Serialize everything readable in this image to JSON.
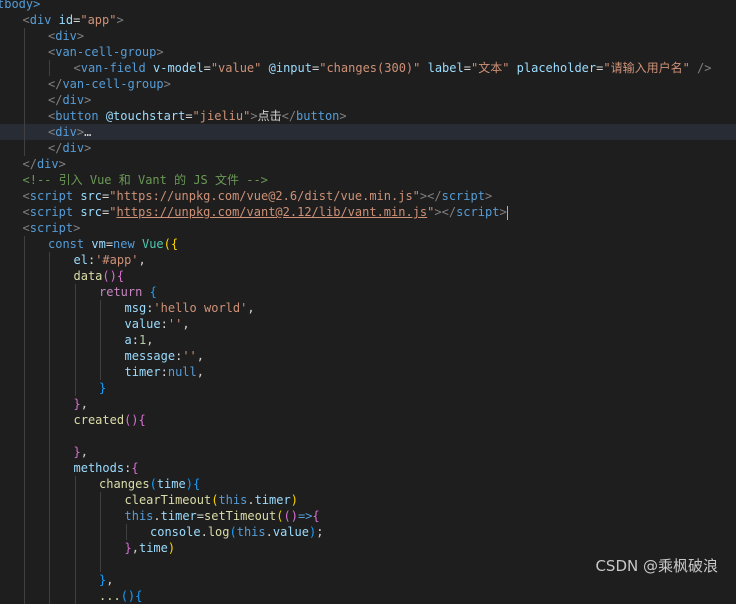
{
  "theme": {
    "background": "#1e1e1e",
    "current_line": "#282d35",
    "tag": "#569cd6",
    "attribute": "#9cdcfe",
    "string": "#ce9178",
    "comment": "#6a9955",
    "control": "#c586c0",
    "function": "#dcdcaa",
    "class": "#4ec9b0",
    "number": "#b5cea8"
  },
  "editor": {
    "current_line_index": 8,
    "lines": [
      {
        "indent": 0,
        "tokens": [
          {
            "t": "tag",
            "v": "tbody>"
          }
        ]
      },
      {
        "indent": 1,
        "tokens": [
          {
            "t": "bracket",
            "v": "<"
          },
          {
            "t": "tag",
            "v": "div"
          },
          {
            "t": "text",
            "v": " "
          },
          {
            "t": "attr",
            "v": "id"
          },
          {
            "t": "text",
            "v": "="
          },
          {
            "t": "string",
            "v": "\"app\""
          },
          {
            "t": "bracket",
            "v": ">"
          }
        ]
      },
      {
        "indent": 2,
        "tokens": [
          {
            "t": "bracket",
            "v": "<"
          },
          {
            "t": "tag",
            "v": "div"
          },
          {
            "t": "bracket",
            "v": ">"
          }
        ]
      },
      {
        "indent": 2,
        "tokens": [
          {
            "t": "bracket",
            "v": "<"
          },
          {
            "t": "tag",
            "v": "van-cell-group"
          },
          {
            "t": "bracket",
            "v": ">"
          }
        ]
      },
      {
        "indent": 3,
        "tokens": [
          {
            "t": "bracket",
            "v": "<"
          },
          {
            "t": "tag",
            "v": "van-field"
          },
          {
            "t": "text",
            "v": " "
          },
          {
            "t": "attr",
            "v": "v-model"
          },
          {
            "t": "text",
            "v": "="
          },
          {
            "t": "string",
            "v": "\"value\""
          },
          {
            "t": "text",
            "v": " "
          },
          {
            "t": "attr",
            "v": "@input"
          },
          {
            "t": "text",
            "v": "="
          },
          {
            "t": "string",
            "v": "\"changes(300)\""
          },
          {
            "t": "text",
            "v": " "
          },
          {
            "t": "attr",
            "v": "label"
          },
          {
            "t": "text",
            "v": "="
          },
          {
            "t": "string",
            "v": "\"文本\""
          },
          {
            "t": "text",
            "v": " "
          },
          {
            "t": "attr",
            "v": "placeholder"
          },
          {
            "t": "text",
            "v": "="
          },
          {
            "t": "string",
            "v": "\"请输入用户名\""
          },
          {
            "t": "text",
            "v": " "
          },
          {
            "t": "bracket",
            "v": "/>"
          }
        ]
      },
      {
        "indent": 2,
        "tokens": [
          {
            "t": "bracket",
            "v": "</"
          },
          {
            "t": "tag",
            "v": "van-cell-group"
          },
          {
            "t": "bracket",
            "v": ">"
          }
        ]
      },
      {
        "indent": 2,
        "tokens": [
          {
            "t": "bracket",
            "v": "</"
          },
          {
            "t": "tag",
            "v": "div"
          },
          {
            "t": "bracket",
            "v": ">"
          }
        ]
      },
      {
        "indent": 2,
        "tokens": [
          {
            "t": "bracket",
            "v": "<"
          },
          {
            "t": "tag",
            "v": "button"
          },
          {
            "t": "text",
            "v": " "
          },
          {
            "t": "attr",
            "v": "@touchstart"
          },
          {
            "t": "text",
            "v": "="
          },
          {
            "t": "string",
            "v": "\"jieliu\""
          },
          {
            "t": "bracket",
            "v": ">"
          },
          {
            "t": "text",
            "v": "点击"
          },
          {
            "t": "bracket",
            "v": "</"
          },
          {
            "t": "tag",
            "v": "button"
          },
          {
            "t": "bracket",
            "v": ">"
          }
        ]
      },
      {
        "indent": 2,
        "tokens": [
          {
            "t": "bracket",
            "v": "<"
          },
          {
            "t": "tag",
            "v": "div"
          },
          {
            "t": "bracket",
            "v": ">"
          },
          {
            "t": "fold",
            "v": "…"
          }
        ]
      },
      {
        "indent": 2,
        "tokens": [
          {
            "t": "bracket",
            "v": "</"
          },
          {
            "t": "tag",
            "v": "div"
          },
          {
            "t": "bracket",
            "v": ">"
          }
        ]
      },
      {
        "indent": 1,
        "tokens": [
          {
            "t": "bracket",
            "v": "</"
          },
          {
            "t": "tag",
            "v": "div"
          },
          {
            "t": "bracket",
            "v": ">"
          }
        ]
      },
      {
        "indent": 1,
        "tokens": [
          {
            "t": "comment",
            "v": "<!-- 引入 Vue 和 Vant 的 JS 文件 -->"
          }
        ]
      },
      {
        "indent": 1,
        "tokens": [
          {
            "t": "bracket",
            "v": "<"
          },
          {
            "t": "tag",
            "v": "script"
          },
          {
            "t": "text",
            "v": " "
          },
          {
            "t": "attr",
            "v": "src"
          },
          {
            "t": "text",
            "v": "="
          },
          {
            "t": "string",
            "v": "\"https://unpkg.com/vue@2.6/dist/vue.min.js\""
          },
          {
            "t": "bracket",
            "v": "></"
          },
          {
            "t": "tag",
            "v": "script"
          },
          {
            "t": "bracket",
            "v": ">"
          }
        ]
      },
      {
        "indent": 1,
        "tokens": [
          {
            "t": "bracket",
            "v": "<"
          },
          {
            "t": "tag",
            "v": "script"
          },
          {
            "t": "text",
            "v": " "
          },
          {
            "t": "attr",
            "v": "src"
          },
          {
            "t": "text",
            "v": "="
          },
          {
            "t": "string",
            "v": "\""
          },
          {
            "t": "link",
            "v": "https://unpkg.com/vant@2.12/lib/vant.min.js"
          },
          {
            "t": "string",
            "v": "\""
          },
          {
            "t": "bracket",
            "v": "></"
          },
          {
            "t": "tag",
            "v": "script"
          },
          {
            "t": "bracket",
            "v": ">"
          },
          {
            "t": "cursor",
            "v": ""
          }
        ]
      },
      {
        "indent": 1,
        "tokens": [
          {
            "t": "bracket",
            "v": "<"
          },
          {
            "t": "tag",
            "v": "script"
          },
          {
            "t": "bracket",
            "v": ">"
          }
        ]
      },
      {
        "indent": 2,
        "tokens": [
          {
            "t": "keyword",
            "v": "const"
          },
          {
            "t": "plain",
            "v": " "
          },
          {
            "t": "var",
            "v": "vm"
          },
          {
            "t": "plain",
            "v": "="
          },
          {
            "t": "keyword",
            "v": "new"
          },
          {
            "t": "plain",
            "v": " "
          },
          {
            "t": "class",
            "v": "Vue"
          },
          {
            "t": "brace1",
            "v": "({"
          }
        ]
      },
      {
        "indent": 3,
        "tokens": [
          {
            "t": "var",
            "v": "el"
          },
          {
            "t": "plain",
            "v": ":"
          },
          {
            "t": "string",
            "v": "'#app'"
          },
          {
            "t": "plain",
            "v": ","
          }
        ]
      },
      {
        "indent": 3,
        "tokens": [
          {
            "t": "func",
            "v": "data"
          },
          {
            "t": "brace2",
            "v": "(){"
          }
        ]
      },
      {
        "indent": 4,
        "tokens": [
          {
            "t": "control",
            "v": "return"
          },
          {
            "t": "plain",
            "v": " "
          },
          {
            "t": "brace3",
            "v": "{"
          }
        ]
      },
      {
        "indent": 5,
        "tokens": [
          {
            "t": "var",
            "v": "msg"
          },
          {
            "t": "plain",
            "v": ":"
          },
          {
            "t": "string",
            "v": "'hello world'"
          },
          {
            "t": "plain",
            "v": ","
          }
        ]
      },
      {
        "indent": 5,
        "tokens": [
          {
            "t": "var",
            "v": "value"
          },
          {
            "t": "plain",
            "v": ":"
          },
          {
            "t": "string",
            "v": "''"
          },
          {
            "t": "plain",
            "v": ","
          }
        ]
      },
      {
        "indent": 5,
        "tokens": [
          {
            "t": "var",
            "v": "a"
          },
          {
            "t": "plain",
            "v": ":"
          },
          {
            "t": "number",
            "v": "1"
          },
          {
            "t": "plain",
            "v": ","
          }
        ]
      },
      {
        "indent": 5,
        "tokens": [
          {
            "t": "var",
            "v": "message"
          },
          {
            "t": "plain",
            "v": ":"
          },
          {
            "t": "string",
            "v": "''"
          },
          {
            "t": "plain",
            "v": ","
          }
        ]
      },
      {
        "indent": 5,
        "tokens": [
          {
            "t": "var",
            "v": "timer"
          },
          {
            "t": "plain",
            "v": ":"
          },
          {
            "t": "keyword",
            "v": "null"
          },
          {
            "t": "plain",
            "v": ","
          }
        ]
      },
      {
        "indent": 4,
        "tokens": [
          {
            "t": "brace3",
            "v": "}"
          }
        ]
      },
      {
        "indent": 3,
        "tokens": [
          {
            "t": "brace2",
            "v": "}"
          },
          {
            "t": "plain",
            "v": ","
          }
        ]
      },
      {
        "indent": 3,
        "tokens": [
          {
            "t": "func",
            "v": "created"
          },
          {
            "t": "brace2",
            "v": "(){"
          }
        ]
      },
      {
        "indent": 3,
        "tokens": []
      },
      {
        "indent": 3,
        "tokens": [
          {
            "t": "brace2",
            "v": "}"
          },
          {
            "t": "plain",
            "v": ","
          }
        ]
      },
      {
        "indent": 3,
        "tokens": [
          {
            "t": "var",
            "v": "methods"
          },
          {
            "t": "plain",
            "v": ":"
          },
          {
            "t": "brace2",
            "v": "{"
          }
        ]
      },
      {
        "indent": 4,
        "tokens": [
          {
            "t": "func",
            "v": "changes"
          },
          {
            "t": "brace3",
            "v": "("
          },
          {
            "t": "var",
            "v": "time"
          },
          {
            "t": "brace3",
            "v": ")"
          },
          {
            "t": "brace3",
            "v": "{"
          }
        ]
      },
      {
        "indent": 5,
        "tokens": [
          {
            "t": "func",
            "v": "clearTimeout"
          },
          {
            "t": "brace1",
            "v": "("
          },
          {
            "t": "keyword",
            "v": "this"
          },
          {
            "t": "plain",
            "v": "."
          },
          {
            "t": "var",
            "v": "timer"
          },
          {
            "t": "brace1",
            "v": ")"
          }
        ]
      },
      {
        "indent": 5,
        "tokens": [
          {
            "t": "keyword",
            "v": "this"
          },
          {
            "t": "plain",
            "v": "."
          },
          {
            "t": "var",
            "v": "timer"
          },
          {
            "t": "plain",
            "v": "="
          },
          {
            "t": "func",
            "v": "setTimeout"
          },
          {
            "t": "brace1",
            "v": "("
          },
          {
            "t": "brace2",
            "v": "()"
          },
          {
            "t": "keyword",
            "v": "=>"
          },
          {
            "t": "brace2",
            "v": "{"
          }
        ]
      },
      {
        "indent": 6,
        "tokens": [
          {
            "t": "var",
            "v": "console"
          },
          {
            "t": "plain",
            "v": "."
          },
          {
            "t": "func",
            "v": "log"
          },
          {
            "t": "brace3",
            "v": "("
          },
          {
            "t": "keyword",
            "v": "this"
          },
          {
            "t": "plain",
            "v": "."
          },
          {
            "t": "var",
            "v": "value"
          },
          {
            "t": "brace3",
            "v": ")"
          },
          {
            "t": "plain",
            "v": ";"
          }
        ]
      },
      {
        "indent": 5,
        "tokens": [
          {
            "t": "brace2",
            "v": "}"
          },
          {
            "t": "plain",
            "v": ","
          },
          {
            "t": "var",
            "v": "time"
          },
          {
            "t": "brace1",
            "v": ")"
          }
        ]
      },
      {
        "indent": 5,
        "tokens": []
      },
      {
        "indent": 4,
        "tokens": [
          {
            "t": "brace3",
            "v": "}"
          },
          {
            "t": "plain",
            "v": ","
          }
        ]
      },
      {
        "indent": 4,
        "tokens": [
          {
            "t": "func",
            "v": "..."
          },
          {
            "t": "brace3",
            "v": "(){"
          }
        ]
      }
    ]
  },
  "watermark": "CSDN @乘枫破浪"
}
